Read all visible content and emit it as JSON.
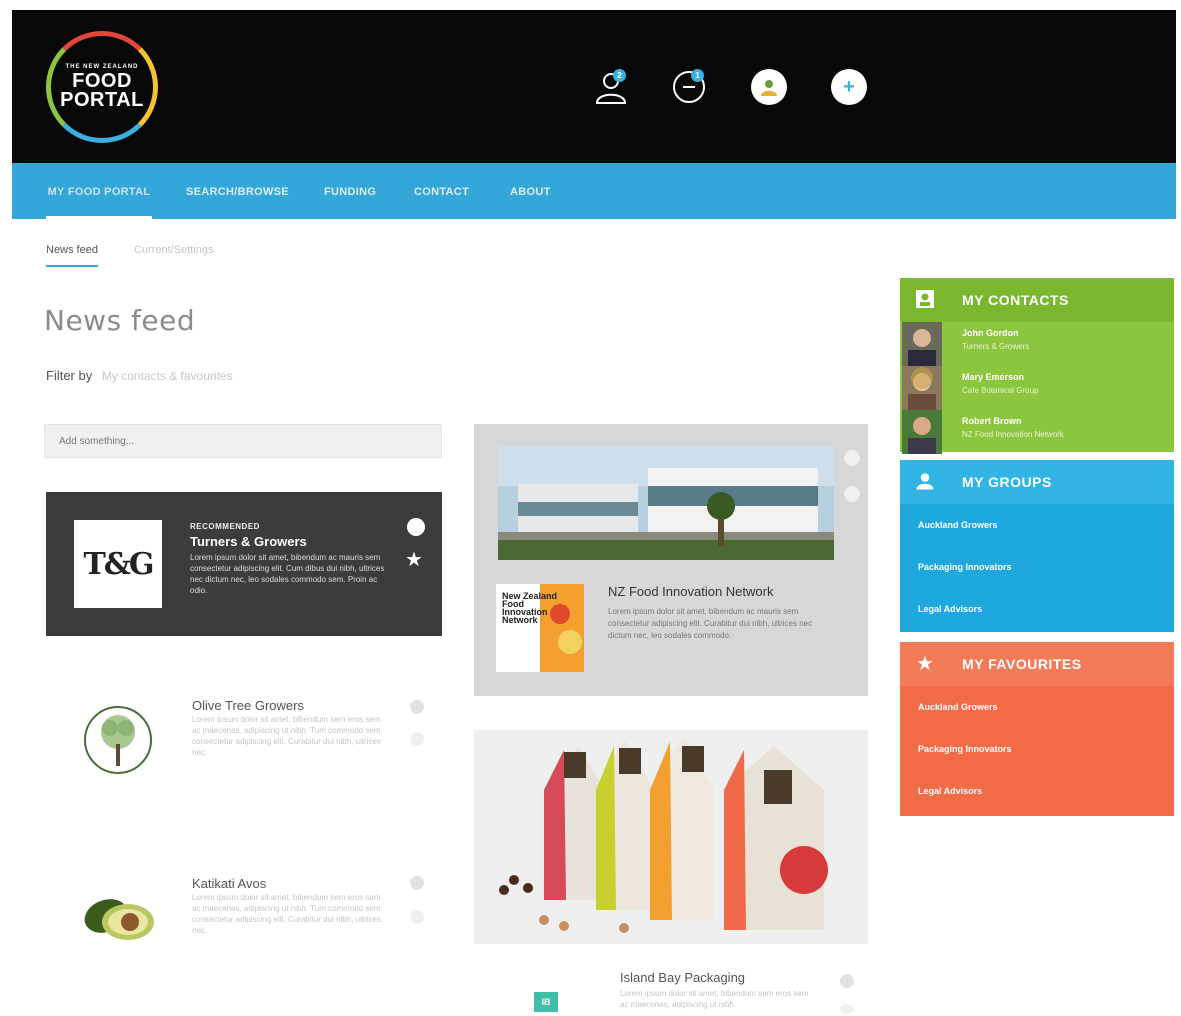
{
  "header": {
    "logo_small": "THE NEW ZEALAND",
    "logo_line1": "FOOD",
    "logo_line2": "PORTAL",
    "contacts_badge": "2",
    "messages_badge": "1",
    "add_label": "+"
  },
  "nav": {
    "items": [
      {
        "label": "My Food Portal"
      },
      {
        "label": "Search/Browse"
      },
      {
        "label": "Funding"
      },
      {
        "label": "Contact"
      },
      {
        "label": "About"
      }
    ]
  },
  "subtabs": [
    {
      "label": "News feed"
    },
    {
      "label": "Current/Settings"
    }
  ],
  "main": {
    "title": "News feed",
    "filter_label": "Filter by",
    "filter_value": "My contacts & favourites",
    "search_placeholder": "Add something..."
  },
  "feed": {
    "recommended": {
      "tag": "RECOMMENDED",
      "logo": "T&G",
      "title": "Turners & Growers",
      "desc": "Lorem ipsum dolor sit amet, bibendum ac mauris sem consectetur adipiscing elit. Cum dibus dui nibh, ultrices nec dictum nec, leo sodales commodo sem. Proin ac odio."
    },
    "olive": {
      "title": "Olive Tree Growers",
      "desc": "Lorem ipsum dolor sit amet, bibendum sem eros sem ac maecenas, adipiscing ut nibh. Tum commodo sem consectetur adipiscing elit. Curabitur dui nibh, ultrices nec."
    },
    "katikati": {
      "title": "Katikati Avos",
      "desc": "Lorem ipsum dolor sit amet, bibendum sem eros sem ac maecenas, adipiscing ut nibh. Tum commodo sem consectetur adipiscing elit. Curabitur dui nibh, ultrices nec."
    },
    "nzfin": {
      "logo_text": "New Zealand Food Innovation Network",
      "title": "NZ Food Innovation Network",
      "desc": "Lorem ipsum dolor sit amet, bibendum ac mauris sem consectetur adipiscing elit. Curabitur dui nibh, ultrices nec dictum nec, leo sodales commodo."
    },
    "island": {
      "icon": "IB",
      "title": "Island Bay Packaging",
      "desc": "Lorem ipsum dolor sit amet, bibendum sem eros sem ac maecenas, adipiscing ut nibh."
    }
  },
  "sidebar": {
    "contacts": {
      "title": "My Contacts",
      "items": [
        {
          "name": "John Gordon",
          "org": "Turners & Growers"
        },
        {
          "name": "Mary Emerson",
          "org": "Cafe Botanical Group"
        },
        {
          "name": "Robert Brown",
          "org": "NZ Food Innovation Network"
        }
      ]
    },
    "groups": {
      "title": "My Groups",
      "items": [
        {
          "label": "Auckland Growers"
        },
        {
          "label": "Packaging Innovators"
        },
        {
          "label": "Legal Advisors"
        }
      ]
    },
    "favourites": {
      "title": "My Favourites",
      "items": [
        {
          "label": "Auckland Growers"
        },
        {
          "label": "Packaging Innovators"
        },
        {
          "label": "Legal Advisors"
        }
      ]
    }
  },
  "colors": {
    "nav_blue": "#35a6d8",
    "contacts_green": "#8cc63f",
    "groups_blue": "#1ea8de",
    "favourites_orange": "#f26b47",
    "dark_card": "#3c3c3c"
  }
}
